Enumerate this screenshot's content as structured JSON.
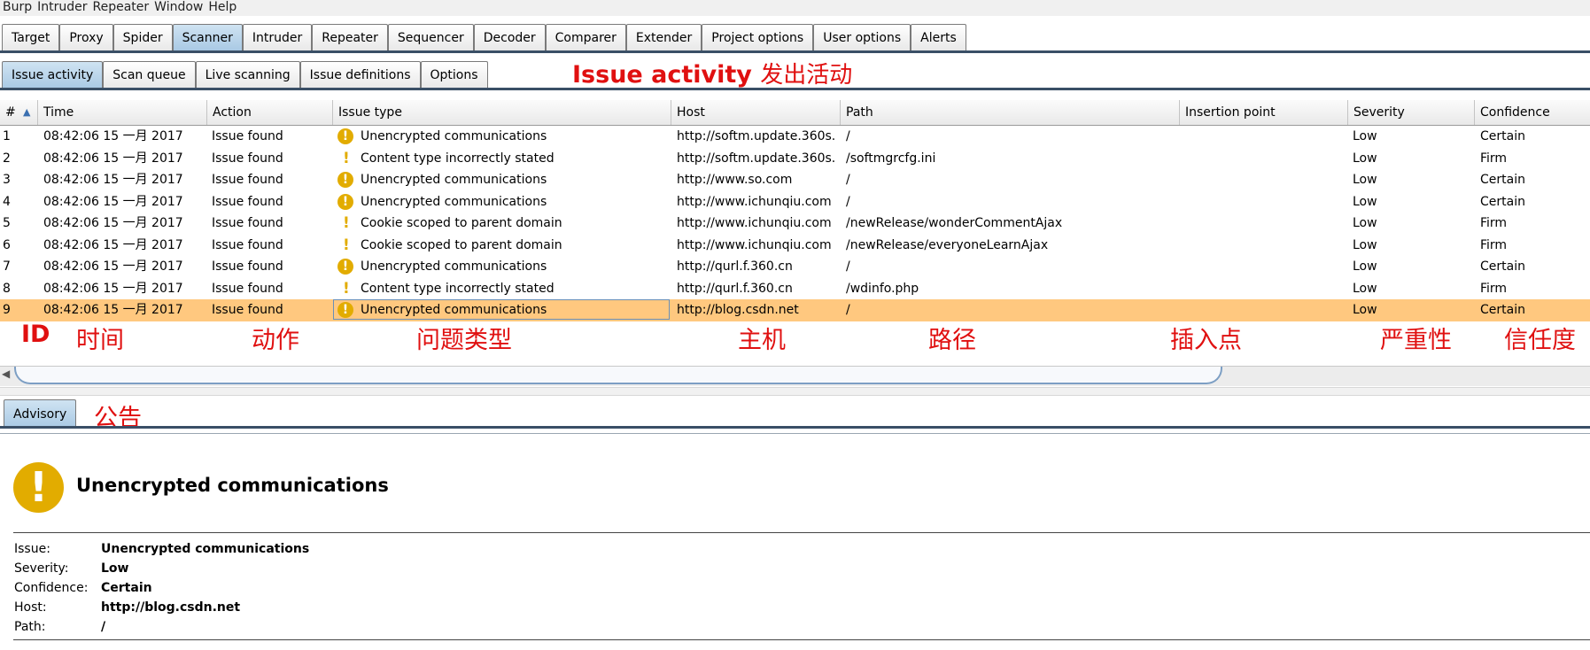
{
  "menu": [
    "Burp",
    "Intruder",
    "Repeater",
    "Window",
    "Help"
  ],
  "main_tabs": [
    "Target",
    "Proxy",
    "Spider",
    "Scanner",
    "Intruder",
    "Repeater",
    "Sequencer",
    "Decoder",
    "Comparer",
    "Extender",
    "Project options",
    "User options",
    "Alerts"
  ],
  "sub_tabs": [
    "Issue activity",
    "Scan queue",
    "Live scanning",
    "Issue definitions",
    "Options"
  ],
  "annotation_issue_activity": {
    "en": "Issue activity",
    "cn": "发出活动"
  },
  "columns": [
    "#",
    "Time",
    "Action",
    "Issue type",
    "Host",
    "Path",
    "Insertion point",
    "Severity",
    "Confidence"
  ],
  "sort_arrow": "▲",
  "rows": [
    {
      "id": "1",
      "time": "08:42:06 15 一月 2017",
      "action": "Issue found",
      "icon": "warning-circle",
      "issue": "Unencrypted communications",
      "host": "http://softm.update.360s...",
      "path": "/",
      "insertion": "",
      "severity": "Low",
      "confidence": "Certain"
    },
    {
      "id": "2",
      "time": "08:42:06 15 一月 2017",
      "action": "Issue found",
      "icon": "exclamation",
      "issue": "Content type incorrectly stated",
      "host": "http://softm.update.360s...",
      "path": "/softmgrcfg.ini",
      "insertion": "",
      "severity": "Low",
      "confidence": "Firm"
    },
    {
      "id": "3",
      "time": "08:42:06 15 一月 2017",
      "action": "Issue found",
      "icon": "warning-circle",
      "issue": "Unencrypted communications",
      "host": "http://www.so.com",
      "path": "/",
      "insertion": "",
      "severity": "Low",
      "confidence": "Certain"
    },
    {
      "id": "4",
      "time": "08:42:06 15 一月 2017",
      "action": "Issue found",
      "icon": "warning-circle",
      "issue": "Unencrypted communications",
      "host": "http://www.ichunqiu.com",
      "path": "/",
      "insertion": "",
      "severity": "Low",
      "confidence": "Certain"
    },
    {
      "id": "5",
      "time": "08:42:06 15 一月 2017",
      "action": "Issue found",
      "icon": "exclamation",
      "issue": "Cookie scoped to parent domain",
      "host": "http://www.ichunqiu.com",
      "path": "/newRelease/wonderCommentAjax",
      "insertion": "",
      "severity": "Low",
      "confidence": "Firm"
    },
    {
      "id": "6",
      "time": "08:42:06 15 一月 2017",
      "action": "Issue found",
      "icon": "exclamation",
      "issue": "Cookie scoped to parent domain",
      "host": "http://www.ichunqiu.com",
      "path": "/newRelease/everyoneLearnAjax",
      "insertion": "",
      "severity": "Low",
      "confidence": "Firm"
    },
    {
      "id": "7",
      "time": "08:42:06 15 一月 2017",
      "action": "Issue found",
      "icon": "warning-circle",
      "issue": "Unencrypted communications",
      "host": "http://qurl.f.360.cn",
      "path": "/",
      "insertion": "",
      "severity": "Low",
      "confidence": "Certain"
    },
    {
      "id": "8",
      "time": "08:42:06 15 一月 2017",
      "action": "Issue found",
      "icon": "exclamation",
      "issue": "Content type incorrectly stated",
      "host": "http://qurl.f.360.cn",
      "path": "/wdinfo.php",
      "insertion": "",
      "severity": "Low",
      "confidence": "Firm"
    },
    {
      "id": "9",
      "time": "08:42:06 15 一月 2017",
      "action": "Issue found",
      "icon": "warning-circle",
      "issue": "Unencrypted communications",
      "host": "http://blog.csdn.net",
      "path": "/",
      "insertion": "",
      "severity": "Low",
      "confidence": "Certain"
    }
  ],
  "selected_row": "9",
  "column_annotations": [
    "ID",
    "时间",
    "动作",
    "问题类型",
    "主机",
    "路径",
    "插入点",
    "严重性",
    "信任度"
  ],
  "advisory_tab": "Advisory",
  "advisory_annotation": "公告",
  "advisory": {
    "icon_glyph": "!",
    "title": "Unencrypted communications",
    "fields": [
      {
        "key": "Issue:",
        "value": "Unencrypted communications"
      },
      {
        "key": "Severity:",
        "value": "Low"
      },
      {
        "key": "Confidence:",
        "value": "Certain"
      },
      {
        "key": "Host:",
        "value": "http://blog.csdn.net"
      },
      {
        "key": "Path:",
        "value": "/"
      }
    ]
  },
  "colors": {
    "warning": "#e2ac00",
    "selected_row": "#ffc87f",
    "annotation_red": "#e01010",
    "tab_active": "#a9c9e4"
  }
}
